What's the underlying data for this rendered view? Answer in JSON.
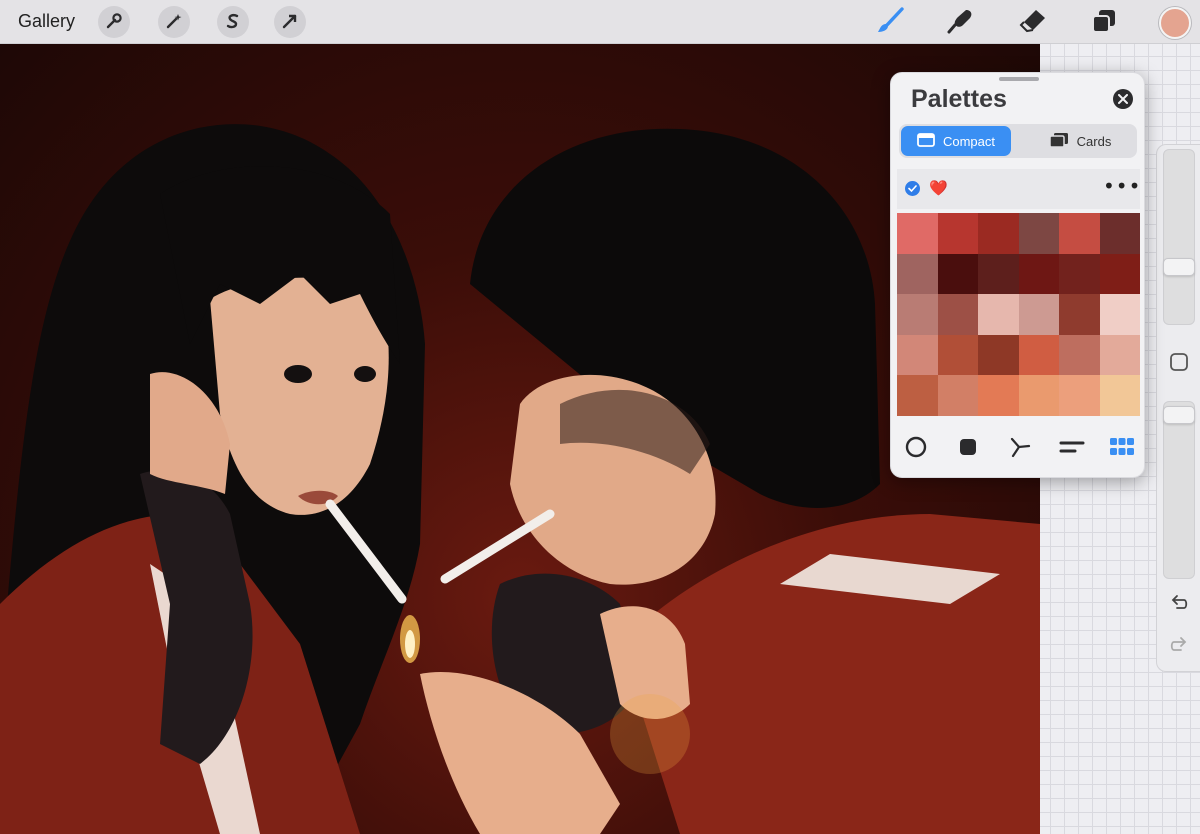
{
  "toolbar": {
    "gallery_label": "Gallery",
    "left_tools": [
      "wrench-icon",
      "magic-wand-icon",
      "selection-s-icon",
      "arrow-transform-icon"
    ],
    "right_tools": [
      "brush-icon",
      "smudge-icon",
      "eraser-icon",
      "layers-icon"
    ],
    "current_color": "#e4a490",
    "active_tool_color": "#3a8ff3"
  },
  "palettes": {
    "title": "Palettes",
    "tabs": [
      {
        "label": "Compact",
        "icon": "compact-icon",
        "active": true
      },
      {
        "label": "Cards",
        "icon": "cards-icon",
        "active": false
      }
    ],
    "palette_name": "❤️",
    "selected": true,
    "swatches": [
      "#e06a66",
      "#b7362f",
      "#9b2a22",
      "#7d4743",
      "#c54d42",
      "#6c2e2c",
      "#9f6460",
      "#4a0e0d",
      "#5d1f1c",
      "#6e1714",
      "#72221d",
      "#7f1e17",
      "#b97c74",
      "#9d5046",
      "#e6b7ad",
      "#cd9a92",
      "#8f3b2e",
      "#f0cec6",
      "#d28778",
      "#b14f37",
      "#8e3826",
      "#d05d42",
      "#be6e5f",
      "#e3aa9a",
      "#bd5f42",
      "#d27f66",
      "#e37a55",
      "#ea9a6e",
      "#ec9f7c",
      "#f2c797"
    ],
    "bottom_tools": [
      "disc-icon",
      "square-icon",
      "harmony-icon",
      "value-icon",
      "palette-grid-icon"
    ]
  },
  "sidebar": {
    "tools": [
      "size-slider",
      "modify-square-icon",
      "opacity-slider",
      "undo-icon",
      "redo-icon"
    ]
  }
}
